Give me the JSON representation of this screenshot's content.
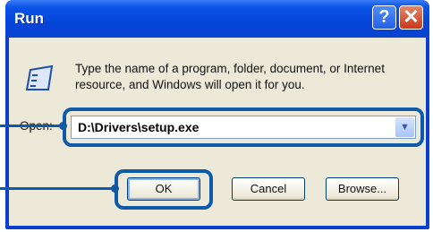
{
  "window": {
    "title": "Run"
  },
  "controls": {
    "help_label": "?",
    "close_label": "✕"
  },
  "description": "Type the name of a program, folder, document, or Internet resource, and Windows will open it for you.",
  "open": {
    "label": "Open:",
    "value": "D:\\Drivers\\setup.exe",
    "dropdown_glyph": "▼"
  },
  "buttons": {
    "ok": "OK",
    "cancel": "Cancel",
    "browse": "Browse..."
  }
}
